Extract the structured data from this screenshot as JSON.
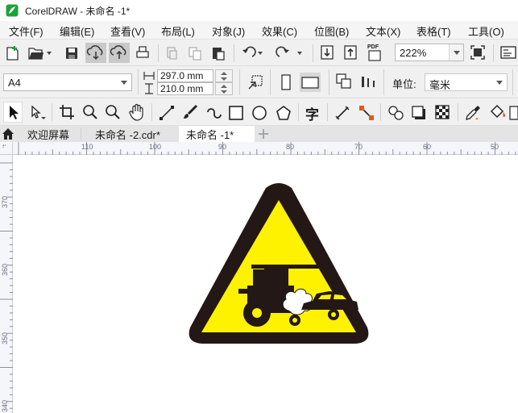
{
  "window": {
    "title": "CorelDRAW - 未命名 -1*",
    "icon": "coreldraw-logo-icon",
    "accent_color": "#1ca33a"
  },
  "menu": [
    "文件(F)",
    "编辑(E)",
    "查看(V)",
    "布局(L)",
    "对象(J)",
    "效果(C)",
    "位图(B)",
    "文本(X)",
    "表格(T)",
    "工具(O)"
  ],
  "standard_toolbar": {
    "icons": [
      "new-document-icon",
      "open-folder-icon",
      "save-icon",
      "cloud-download-icon",
      "cloud-upload-icon",
      "print-icon",
      "cut-icon",
      "copy-icon",
      "paste-icon",
      "undo-icon",
      "redo-icon",
      "import-icon",
      "export-icon",
      "publish-pdf-icon",
      "full-screen-icon",
      "options-icon"
    ],
    "pdf_label": "PDF",
    "zoom_value": "222%"
  },
  "property_bar": {
    "page_size": "A4",
    "width": "297.0 mm",
    "height": "210.0 mm",
    "units_label": "单位:",
    "units_value": "毫米",
    "icons": [
      "width-icon",
      "height-icon",
      "apply-all-pages-icon",
      "portrait-icon",
      "landscape-icon",
      "all-pages-icon",
      "current-page-icon",
      "nudge-icon"
    ]
  },
  "toolbox": {
    "icons": [
      "pick-tool-icon",
      "shape-tool-icon",
      "crop-tool-icon",
      "zoom-tool-icon",
      "zoom-alt-icon",
      "pan-hand-icon",
      "freehand-tool-icon",
      "artistic-media-icon",
      "pen-tool-icon",
      "rectangle-tool-icon",
      "ellipse-tool-icon",
      "polygon-tool-icon",
      "text-tool-icon",
      "parallel-dimension-icon",
      "connector-tool-icon",
      "blend-tool-icon",
      "drop-shadow-icon",
      "transparency-icon",
      "eyedropper-icon",
      "interactive-fill-icon"
    ],
    "text_tool_label": "字"
  },
  "document_tabs": {
    "home_icon": "home-icon",
    "tabs": [
      "欢迎屏幕",
      "未命名 -2.cdr*",
      "未命名 -1*"
    ],
    "active_index": 2,
    "add_tab_icon": "add-tab-icon"
  },
  "rulers": {
    "horizontal_labels": [
      "110",
      "100",
      "90",
      "80",
      "70",
      "60",
      "50"
    ],
    "vertical_labels": [
      "370",
      "360",
      "350",
      "340"
    ]
  },
  "canvas": {
    "object": "warning-sign-icon",
    "colors": {
      "triangle_fill": "#fff200",
      "outline": "#231815",
      "smoke": "#ffffff"
    }
  }
}
